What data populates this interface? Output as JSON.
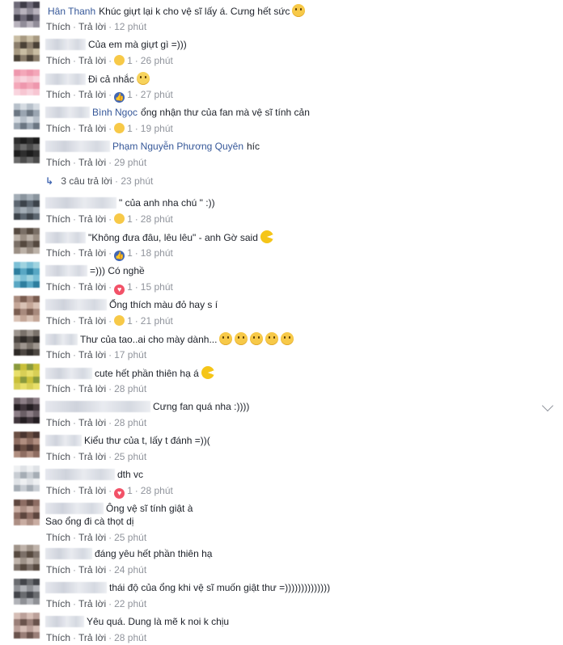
{
  "labels": {
    "like": "Thích",
    "reply": "Trả lời",
    "dot": "·"
  },
  "comments": [
    {
      "name": "Hân Thanh",
      "text": "Khúc giựt lại k cho vệ sĩ lấy á. Cưng hết sức",
      "emoji": "kiss",
      "time": "12 phút",
      "reaction": null,
      "count": null
    },
    {
      "name": "",
      "text": "Của em mà giựt gì =)))",
      "emoji": null,
      "time": "26 phút",
      "reaction": "haha",
      "count": "1"
    },
    {
      "name": "",
      "text": "Đi cả nhắc",
      "emoji": "cry",
      "time": "27 phút",
      "reaction": "like",
      "count": "1"
    },
    {
      "name": "Bình Ngọc",
      "text": "ổng nhận thư của fan mà vệ sĩ tính cản",
      "emoji": null,
      "time": "19 phút",
      "reaction": "haha",
      "count": "1"
    },
    {
      "name": "Phạm Nguyễn Phương Quyên",
      "text": "híc",
      "emoji": null,
      "time": "29 phút",
      "reaction": null,
      "count": null
    },
    {
      "name": "",
      "text": "\" của anh nha chú \" :))",
      "emoji": null,
      "time": "28 phút",
      "reaction": "haha",
      "count": "1"
    },
    {
      "name": "",
      "text": "\"Không đưa đâu, lêu lêu\" - anh Gờ said",
      "emoji": "pac",
      "time": "18 phút",
      "reaction": "like",
      "count": "1"
    },
    {
      "name": "",
      "text": "=))) Có nghề",
      "emoji": null,
      "time": "15 phút",
      "reaction": "love",
      "count": "1"
    },
    {
      "name": "",
      "text": "Ổng thích màu đỏ hay s í",
      "emoji": null,
      "time": "21 phút",
      "reaction": "haha",
      "count": "1"
    },
    {
      "name": "",
      "text": "Thư của tao..ai cho mày dành...",
      "emoji": "grin5",
      "time": "17 phút",
      "reaction": null,
      "count": null
    },
    {
      "name": "",
      "text": "cute hết phần thiên hạ á",
      "emoji": "pac",
      "time": "28 phút",
      "reaction": null,
      "count": null
    },
    {
      "name": "",
      "text": "Cưng fan quá nha :))))",
      "emoji": null,
      "time": "28 phút",
      "reaction": null,
      "count": null
    },
    {
      "name": "",
      "text": "Kiểu thư của t, lấy t đánh =))(",
      "emoji": null,
      "time": "25 phút",
      "reaction": null,
      "count": null
    },
    {
      "name": "",
      "text": "dth vc",
      "emoji": null,
      "time": "28 phút",
      "reaction": "love",
      "count": "1"
    },
    {
      "name": "",
      "text": "Ông vệ sĩ tính giật à",
      "text2": "Sao ổng đi cà thọt dị",
      "emoji": null,
      "time": "25 phút",
      "reaction": null,
      "count": null
    },
    {
      "name": "",
      "text": "đáng yêu hết phần thiên hạ",
      "emoji": null,
      "time": "24 phút",
      "reaction": null,
      "count": null
    },
    {
      "name": "",
      "text": "thái độ của ổng khi vệ sĩ muốn giật thư =))))))))))))))",
      "emoji": null,
      "time": "22 phút",
      "reaction": null,
      "count": null
    },
    {
      "name": "",
      "text": "Yêu quá. Dung là mẽ k noi k chịu",
      "emoji": null,
      "time": "28 phút",
      "reaction": null,
      "count": null
    }
  ],
  "replies": {
    "label": "3 câu trả lời",
    "time": "23 phút"
  },
  "colors": {
    "link": "#365899",
    "meta": "#90949c",
    "accent": "#4267b2",
    "love": "#f25268"
  }
}
